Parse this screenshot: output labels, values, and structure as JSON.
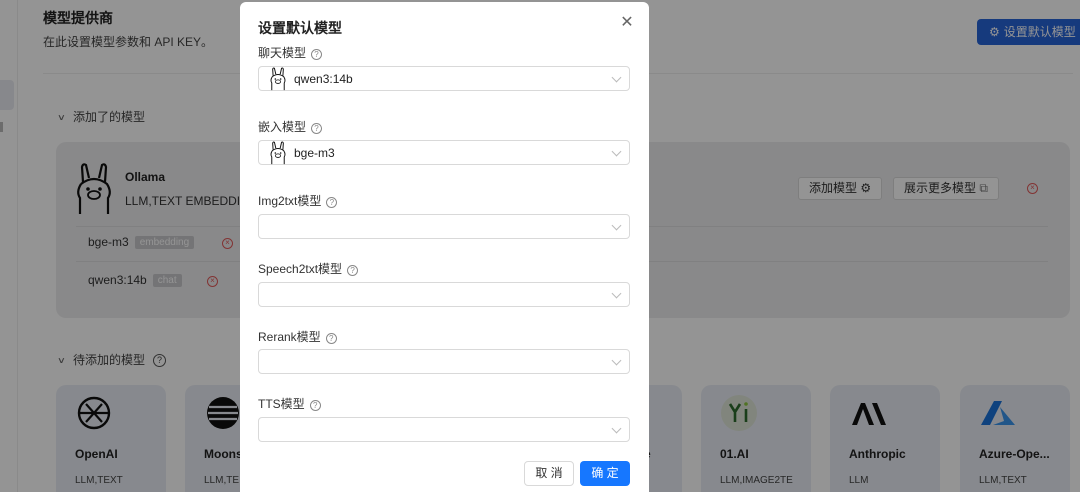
{
  "page": {
    "title": "模型提供商",
    "subtitle": "在此设置模型参数和 API KEY。",
    "set_default_button": "设置默认模型"
  },
  "added_section": {
    "heading": "添加了的模型",
    "provider": {
      "name": "Ollama",
      "tags": "LLM,TEXT EMBEDDING",
      "add_model_button": "添加模型",
      "show_more_button": "展示更多模型"
    },
    "models": [
      {
        "name": "bge-m3",
        "type": "embedding"
      },
      {
        "name": "qwen3:14b",
        "type": "chat"
      }
    ]
  },
  "pending_section": {
    "heading": "待添加的模型",
    "providers": [
      {
        "name": "OpenAI",
        "tags": "LLM,TEXT"
      },
      {
        "name": "Moons",
        "tags": "LLM,TE"
      },
      {
        "name": "e",
        "tags": ""
      },
      {
        "name": "01.AI",
        "tags": "LLM,IMAGE2TE"
      },
      {
        "name": "Anthropic",
        "tags": "LLM"
      },
      {
        "name": "Azure-Ope...",
        "tags": "LLM,TEXT"
      }
    ]
  },
  "modal": {
    "title": "设置默认模型",
    "fields": [
      {
        "label": "聊天模型",
        "value": "qwen3:14b",
        "icon": "ollama-llama-icon"
      },
      {
        "label": "嵌入模型",
        "value": "bge-m3",
        "icon": "ollama-llama-icon"
      },
      {
        "label": "Img2txt模型",
        "value": ""
      },
      {
        "label": "Speech2txt模型",
        "value": ""
      },
      {
        "label": "Rerank模型",
        "value": ""
      },
      {
        "label": "TTS模型",
        "value": ""
      }
    ],
    "cancel_label": "取 消",
    "ok_label": "确 定"
  },
  "colors": {
    "primary": "#1677ff",
    "header_button": "#2764d8",
    "danger": "#e05a5a"
  }
}
